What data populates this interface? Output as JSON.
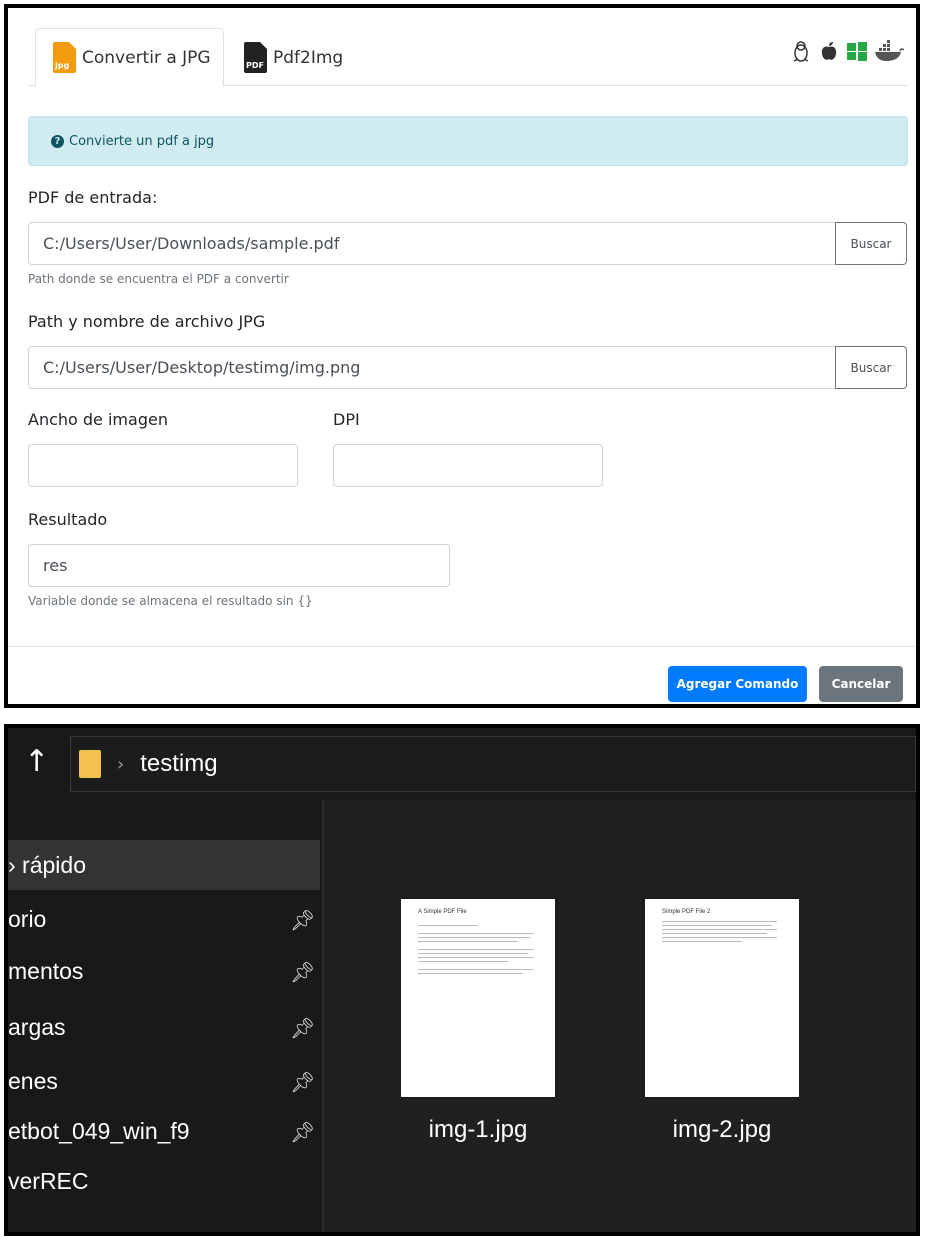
{
  "dialog": {
    "tabs": [
      {
        "label": "Convertir a JPG",
        "icon": "jpg-file-icon",
        "icon_tag": "jpg"
      },
      {
        "label": "Pdf2Img",
        "icon": "pdf-file-icon",
        "icon_tag": "PDF"
      }
    ],
    "os_icons": [
      "linux-icon",
      "apple-icon",
      "windows-icon",
      "docker-icon"
    ],
    "alert": {
      "text": "Convierte un pdf a jpg"
    },
    "pdf_input": {
      "label": "PDF de entrada:",
      "value": "C:/Users/User/Downloads/sample.pdf",
      "button": "Buscar",
      "help": "Path donde se encuentra el PDF a convertir"
    },
    "jpg_output": {
      "label": "Path y nombre de archivo JPG",
      "value": "C:/Users/User/Desktop/testimg/img.png",
      "button": "Buscar"
    },
    "width": {
      "label": "Ancho de imagen",
      "value": ""
    },
    "dpi": {
      "label": "DPI",
      "value": ""
    },
    "result": {
      "label": "Resultado",
      "value": "res",
      "help": "Variable donde se almacena el resultado sin {}"
    },
    "buttons": {
      "add": "Agregar Comando",
      "cancel": "Cancelar"
    },
    "colors": {
      "primary": "#007bff",
      "secondary": "#6c757d",
      "alert_bg": "#d1ecf1",
      "alert_text": "#0c5460"
    }
  },
  "explorer": {
    "up_arrow": "↑",
    "breadcrumb": "testimg",
    "nav_items": [
      {
        "label": "› rápido",
        "pinned": false,
        "selected": true
      },
      {
        "label": "orio",
        "pinned": true
      },
      {
        "label": "mentos",
        "pinned": true
      },
      {
        "label": "argas",
        "pinned": true
      },
      {
        "label": "enes",
        "pinned": true
      },
      {
        "label": "etbot_049_win_f9",
        "pinned": true
      },
      {
        "label": "verREC",
        "pinned": false
      }
    ],
    "files": [
      {
        "name": "img-1.jpg",
        "page_title": "A Simple PDF File"
      },
      {
        "name": "img-2.jpg",
        "page_title": "Simple PDF File 2"
      }
    ]
  }
}
